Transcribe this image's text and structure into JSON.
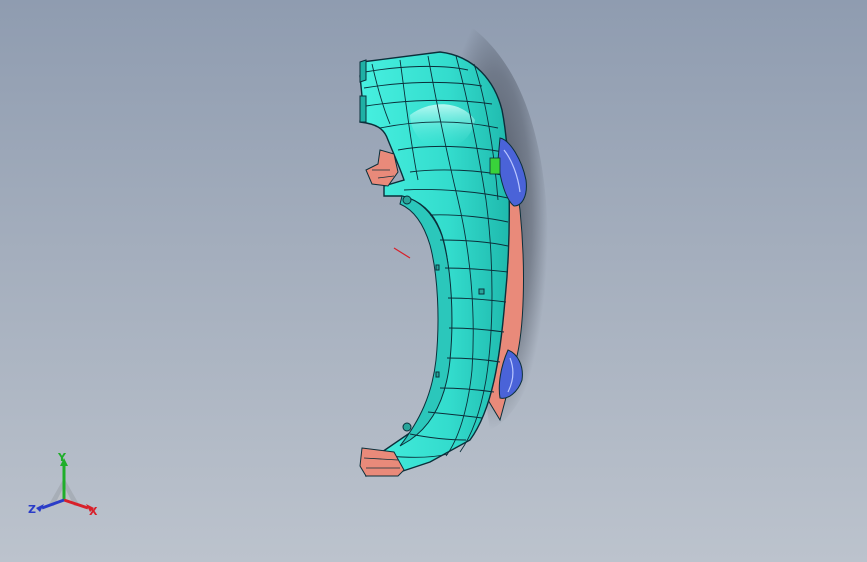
{
  "viewport": {
    "background_top": "#8f9cb0",
    "background_bottom": "#bcc3cd"
  },
  "model": {
    "part": "bumper-surface-model",
    "colors": {
      "surface": "#3ee6d6",
      "edges": "#0b2f3a",
      "inner_surface": "#e98a7a",
      "highlight_face": "#39d23a",
      "grille": "#4a63d8",
      "shadow": "#2a2f3a"
    }
  },
  "triad": {
    "x_label": "X",
    "y_label": "Y",
    "z_label": "Z",
    "x_color": "#d8202a",
    "y_color": "#1fae2a",
    "z_color": "#2a3cc8"
  }
}
